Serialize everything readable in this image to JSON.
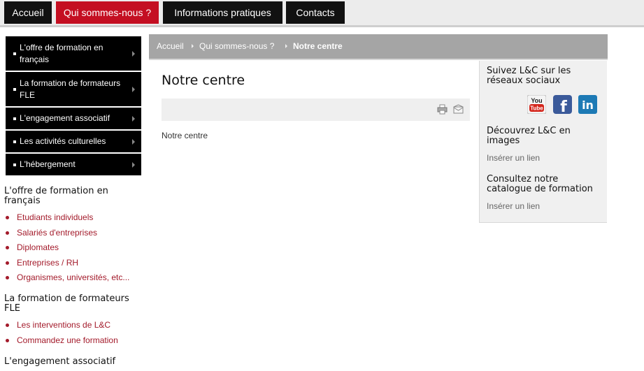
{
  "topnav": {
    "items": [
      {
        "label": "Accueil"
      },
      {
        "label": "Qui sommes-nous ?"
      },
      {
        "label": "Informations pratiques"
      },
      {
        "label": "Contacts"
      }
    ]
  },
  "leftmenu": {
    "items": [
      {
        "label": "L'offre de formation en français"
      },
      {
        "label": "La formation de formateurs FLE"
      },
      {
        "label": "L'engagement associatif"
      },
      {
        "label": "Les activités culturelles"
      },
      {
        "label": "L'hébergement"
      }
    ]
  },
  "sidebar": {
    "sections": [
      {
        "title": "L'offre de formation en français",
        "links": [
          "Etudiants individuels",
          "Salariés d'entreprises",
          "Diplomates",
          "Entreprises / RH",
          "Organismes, universités, etc..."
        ]
      },
      {
        "title": "La formation de formateurs FLE",
        "links": [
          "Les interventions de L&C",
          "Commandez une formation"
        ]
      },
      {
        "title": "L'engagement associatif",
        "links": []
      }
    ]
  },
  "breadcrumb": {
    "items": [
      "Accueil",
      "Qui sommes-nous ?",
      "Notre centre"
    ]
  },
  "main": {
    "title": "Notre centre",
    "body": "Notre centre"
  },
  "rightcol": {
    "social_title": "Suivez L&C sur les réseaux sociaux",
    "social_icons": [
      "youtube-icon",
      "facebook-icon",
      "linkedin-icon"
    ],
    "images_title": "Découvrez L&C en images",
    "images_link": "Insérer un lien",
    "catalogue_title": "Consultez notre catalogue de formation",
    "catalogue_link": "Insérer un lien"
  },
  "colors": {
    "accent": "#c40f22",
    "nav_bg": "#111111",
    "link": "#a31a2a",
    "breadcrumb_bg": "#a5a5a5"
  }
}
